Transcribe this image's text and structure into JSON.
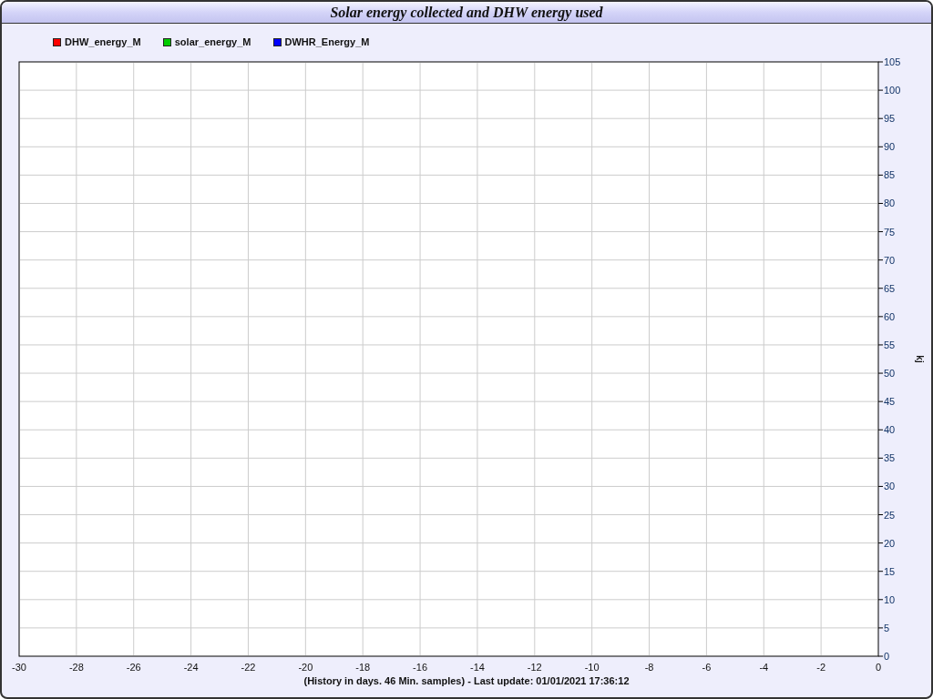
{
  "chart_data": {
    "type": "line",
    "title": "Solar energy collected and DHW energy used",
    "xlabel": "(History in days. 46 Min. samples) - Last update: 01/01/2021 17:36:12",
    "ylabel": "kj",
    "grid": true,
    "series": [
      {
        "name": "DHW_energy_M",
        "color": "#ff0000",
        "values": [
          null,
          null,
          null,
          null,
          null,
          null,
          null,
          null,
          null,
          null,
          null,
          null,
          null,
          null,
          null,
          null
        ]
      },
      {
        "name": "solar_energy_M",
        "color": "#00cc00",
        "values": [
          null,
          null,
          null,
          null,
          null,
          null,
          null,
          null,
          null,
          null,
          null,
          null,
          null,
          null,
          null,
          null
        ]
      },
      {
        "name": "DWHR_Energy_M",
        "color": "#0000ff",
        "values": [
          null,
          null,
          null,
          null,
          null,
          null,
          null,
          null,
          null,
          null,
          null,
          null,
          null,
          null,
          null,
          null
        ]
      }
    ],
    "categories": [
      "-30",
      "-28",
      "-26",
      "-24",
      "-22",
      "-20",
      "-18",
      "-16",
      "-14",
      "-12",
      "-10",
      "-8",
      "-6",
      "-4",
      "-2",
      "0"
    ],
    "ylim": [
      0,
      105
    ],
    "yticks": [
      0,
      5,
      10,
      15,
      20,
      25,
      30,
      35,
      40,
      45,
      50,
      55,
      60,
      65,
      70,
      75,
      80,
      85,
      90,
      95,
      100,
      105
    ]
  }
}
